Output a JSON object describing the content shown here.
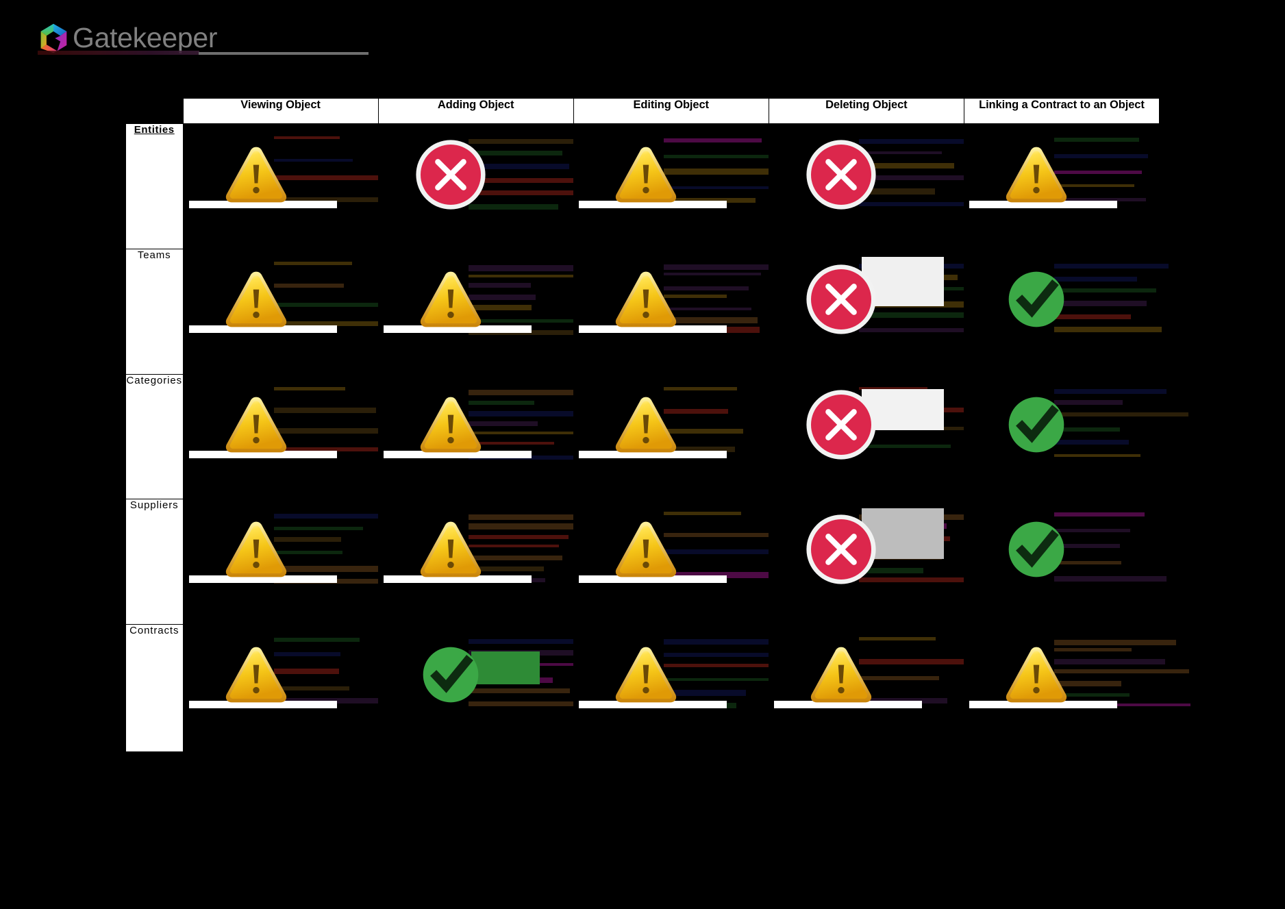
{
  "brand": {
    "name": "Gatekeeper",
    "logo_icon": "gatekeeper-hexagon-g-logo",
    "wordmark_color": "#808080"
  },
  "matrix": {
    "corner_label": "",
    "columns": [
      {
        "id": "viewing",
        "label": "Viewing Object"
      },
      {
        "id": "adding",
        "label": "Adding Object"
      },
      {
        "id": "editing",
        "label": "Editing Object"
      },
      {
        "id": "deleting",
        "label": "Deleting Object"
      },
      {
        "id": "linking",
        "label": "Linking a Contract to an Object"
      }
    ],
    "rows": [
      {
        "id": "entities",
        "label": "Entities",
        "emphasis": true
      },
      {
        "id": "teams",
        "label": "Teams",
        "emphasis": false
      },
      {
        "id": "categories",
        "label": "Categories",
        "emphasis": false
      },
      {
        "id": "suppliers",
        "label": "Suppliers",
        "emphasis": false
      },
      {
        "id": "contracts",
        "label": "Contracts",
        "emphasis": false
      }
    ],
    "cells": [
      [
        {
          "status": "warning",
          "icon": "warning-triangle-icon"
        },
        {
          "status": "denied",
          "icon": "red-x-circle-icon"
        },
        {
          "status": "warning",
          "icon": "warning-triangle-icon"
        },
        {
          "status": "denied",
          "icon": "red-x-circle-icon"
        },
        {
          "status": "warning",
          "icon": "warning-triangle-icon"
        }
      ],
      [
        {
          "status": "warning",
          "icon": "warning-triangle-icon"
        },
        {
          "status": "warning",
          "icon": "warning-triangle-icon"
        },
        {
          "status": "warning",
          "icon": "warning-triangle-icon"
        },
        {
          "status": "denied",
          "icon": "red-x-circle-icon"
        },
        {
          "status": "allowed",
          "icon": "green-check-circle-icon"
        }
      ],
      [
        {
          "status": "warning",
          "icon": "warning-triangle-icon"
        },
        {
          "status": "warning",
          "icon": "warning-triangle-icon"
        },
        {
          "status": "warning",
          "icon": "warning-triangle-icon"
        },
        {
          "status": "denied",
          "icon": "red-x-circle-icon"
        },
        {
          "status": "allowed",
          "icon": "green-check-circle-icon"
        }
      ],
      [
        {
          "status": "warning",
          "icon": "warning-triangle-icon"
        },
        {
          "status": "warning",
          "icon": "warning-triangle-icon"
        },
        {
          "status": "warning",
          "icon": "warning-triangle-icon"
        },
        {
          "status": "denied",
          "icon": "red-x-circle-icon"
        },
        {
          "status": "allowed",
          "icon": "green-check-circle-icon"
        }
      ],
      [
        {
          "status": "warning",
          "icon": "warning-triangle-icon"
        },
        {
          "status": "allowed",
          "icon": "green-check-circle-icon"
        },
        {
          "status": "warning",
          "icon": "warning-triangle-icon"
        },
        {
          "status": "warning",
          "icon": "warning-triangle-icon"
        },
        {
          "status": "warning",
          "icon": "warning-triangle-icon"
        }
      ]
    ]
  },
  "legend_colors": {
    "warning": "#F5C518",
    "denied": "#DC274C",
    "allowed": "#3BA846",
    "page_background": "#000000",
    "header_background": "#FFFFFF",
    "header_text": "#000000"
  }
}
